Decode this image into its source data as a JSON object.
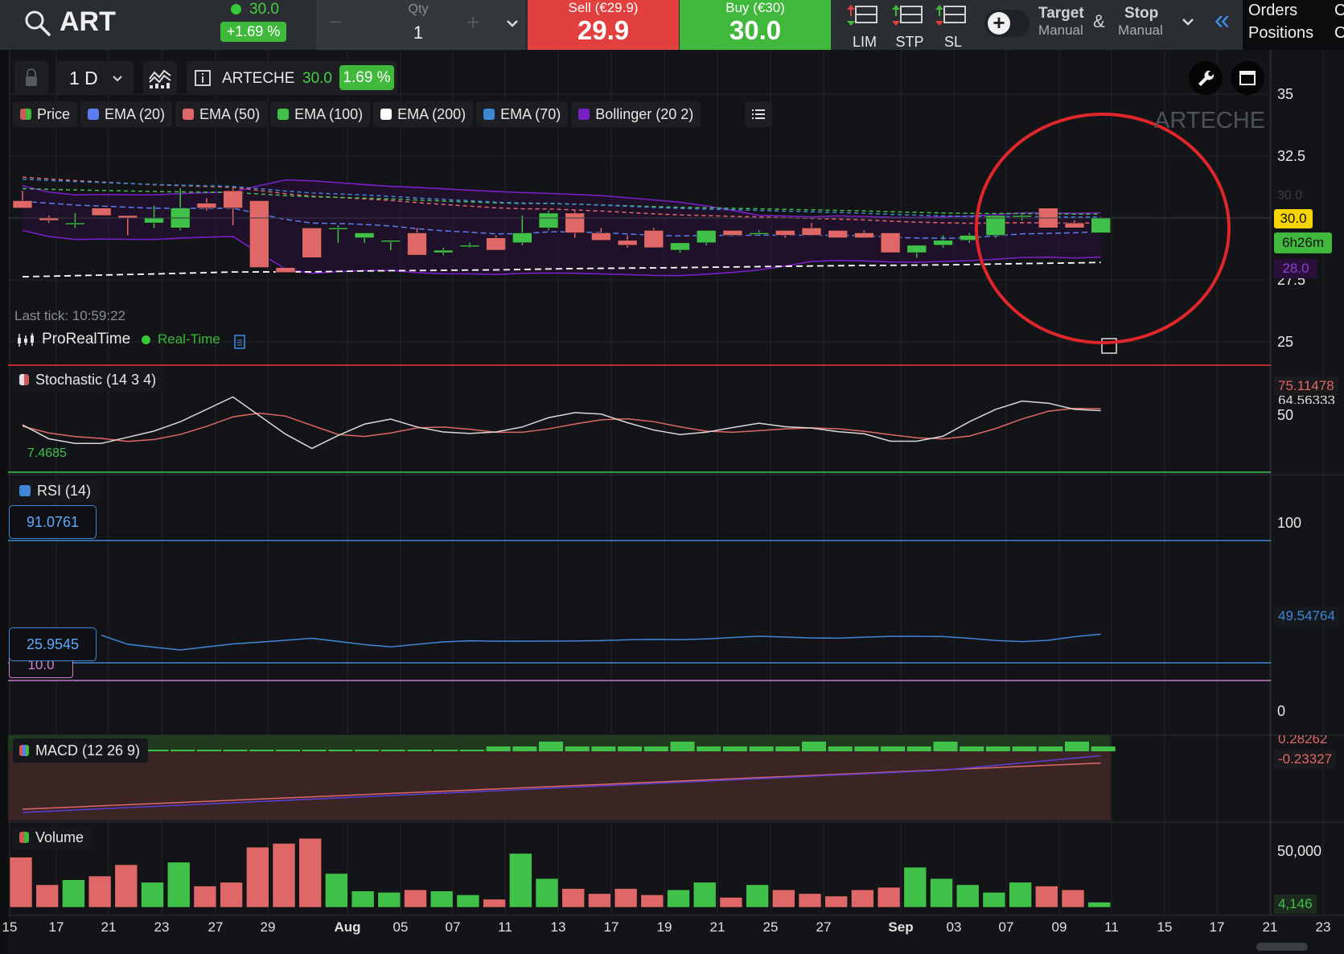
{
  "topbar": {
    "symbol": "ART",
    "last_price": "30.0",
    "change_pct": "+1.69 %",
    "qty_label": "Qty",
    "qty_value": "1",
    "qty_minus": "−",
    "qty_plus": "+",
    "sell_label": "Sell (€29.9)",
    "sell_price": "29.9",
    "buy_label": "Buy (€30)",
    "buy_price": "30.0",
    "order_types": [
      "LIM",
      "STP",
      "SL"
    ],
    "target_label": "Target",
    "target_sub": "Manual",
    "amp": "&",
    "stop_label": "Stop",
    "stop_sub": "Manual",
    "collapse_glyph": "«",
    "orders_label": "Orders",
    "positions_label": "Positions",
    "orders_extra": "C",
    "positions_extra": "C",
    "colors": {
      "sell": "#e2403f",
      "buy": "#3fb83c",
      "dot_green": "#37c837"
    }
  },
  "chart_toolbar": {
    "timeframe": "1 D",
    "instrument": "ARTECHE",
    "instrument_price": "30.0",
    "instrument_change": "1.69 %"
  },
  "legend": [
    {
      "label": "Price",
      "color": "#d05a5a",
      "color2": "#3fb83c"
    },
    {
      "label": "EMA (20)",
      "color": "#5b7cf0"
    },
    {
      "label": "EMA (50)",
      "color": "#e06767"
    },
    {
      "label": "EMA (100)",
      "color": "#3fc14a"
    },
    {
      "label": "EMA (200)",
      "color": "#ffffff"
    },
    {
      "label": "EMA (70)",
      "color": "#3f86d6"
    },
    {
      "label": "Bollinger (20 2)",
      "color": "#7a1fc7"
    }
  ],
  "watermark": "ARTECHE",
  "last_tick": "Last tick: 10:59:22",
  "provider": "ProRealTime",
  "realtime": "Real-Time",
  "price_axis": {
    "ticks": [
      "35",
      "32.5",
      "27.5",
      "25"
    ],
    "hidden_tick": "30.0",
    "last_price_tag": "30.0",
    "countdown_tag": "6h26m",
    "bollinger_tag": "28.0"
  },
  "stochastic": {
    "label": "Stochastic (14 3 4)",
    "value_a": "75.11478",
    "value_b": "64.56333",
    "tick_50": "50",
    "low_label": "7.4685"
  },
  "rsi": {
    "label": "RSI (14)",
    "upper_box": "91.0761",
    "lower_box": "25.9545",
    "hidden_box": "10.0",
    "value": "49.54764",
    "tick_100": "100",
    "tick_0": "0"
  },
  "macd": {
    "label": "MACD (12 26 9)",
    "value_a": "0.28262",
    "value_b": "-0.23327"
  },
  "volume": {
    "label": "Volume",
    "tick_top": "50,000",
    "last_value": "4,146"
  },
  "x_axis": {
    "labels": [
      "15",
      "17",
      "21",
      "23",
      "27",
      "29",
      "Aug",
      "05",
      "07",
      "11",
      "13",
      "17",
      "19",
      "21",
      "25",
      "27",
      "Sep",
      "03",
      "07",
      "09",
      "11",
      "15",
      "17",
      "21",
      "23"
    ],
    "bold": [
      "Aug",
      "Sep"
    ]
  },
  "annotation": {
    "color": "#e1262b"
  },
  "chart_data": {
    "type": "candlestick",
    "candles": [
      {
        "o": 30.7,
        "h": 31.1,
        "l": 30.4,
        "c": 30.4
      },
      {
        "o": 30.0,
        "h": 30.1,
        "l": 29.8,
        "c": 29.9
      },
      {
        "o": 29.8,
        "h": 30.2,
        "l": 29.6,
        "c": 29.8
      },
      {
        "o": 30.4,
        "h": 30.4,
        "l": 30.1,
        "c": 30.1
      },
      {
        "o": 30.1,
        "h": 30.1,
        "l": 29.3,
        "c": 30.0
      },
      {
        "o": 29.8,
        "h": 30.5,
        "l": 29.6,
        "c": 30.0
      },
      {
        "o": 29.6,
        "h": 31.2,
        "l": 29.5,
        "c": 30.4
      },
      {
        "o": 30.6,
        "h": 30.8,
        "l": 30.3,
        "c": 30.4
      },
      {
        "o": 31.1,
        "h": 31.2,
        "l": 29.7,
        "c": 30.4
      },
      {
        "o": 30.7,
        "h": 30.7,
        "l": 28.0,
        "c": 28.0
      },
      {
        "o": 28.0,
        "h": 28.0,
        "l": 27.8,
        "c": 27.8
      },
      {
        "o": 29.6,
        "h": 29.6,
        "l": 28.4,
        "c": 28.4
      },
      {
        "o": 29.6,
        "h": 29.7,
        "l": 29.0,
        "c": 29.6
      },
      {
        "o": 29.2,
        "h": 29.4,
        "l": 29.0,
        "c": 29.4
      },
      {
        "o": 29.1,
        "h": 29.1,
        "l": 28.7,
        "c": 29.1
      },
      {
        "o": 29.4,
        "h": 29.6,
        "l": 28.6,
        "c": 28.5
      },
      {
        "o": 28.6,
        "h": 28.8,
        "l": 28.5,
        "c": 28.7
      },
      {
        "o": 28.9,
        "h": 29.0,
        "l": 28.8,
        "c": 28.9
      },
      {
        "o": 29.2,
        "h": 29.3,
        "l": 28.7,
        "c": 28.7
      },
      {
        "o": 29.0,
        "h": 30.1,
        "l": 28.9,
        "c": 29.4
      },
      {
        "o": 29.6,
        "h": 30.3,
        "l": 29.5,
        "c": 30.2
      },
      {
        "o": 30.2,
        "h": 30.3,
        "l": 29.2,
        "c": 29.4
      },
      {
        "o": 29.4,
        "h": 29.6,
        "l": 29.1,
        "c": 29.1
      },
      {
        "o": 29.1,
        "h": 29.3,
        "l": 28.8,
        "c": 28.9
      },
      {
        "o": 29.5,
        "h": 29.6,
        "l": 28.8,
        "c": 28.8
      },
      {
        "o": 28.7,
        "h": 29.0,
        "l": 28.6,
        "c": 29.0
      },
      {
        "o": 29.0,
        "h": 29.5,
        "l": 28.9,
        "c": 29.5
      },
      {
        "o": 29.5,
        "h": 29.5,
        "l": 29.3,
        "c": 29.3
      },
      {
        "o": 29.4,
        "h": 29.5,
        "l": 29.3,
        "c": 29.4
      },
      {
        "o": 29.5,
        "h": 29.5,
        "l": 29.2,
        "c": 29.3
      },
      {
        "o": 29.6,
        "h": 29.8,
        "l": 29.3,
        "c": 29.3
      },
      {
        "o": 29.5,
        "h": 29.5,
        "l": 29.2,
        "c": 29.2
      },
      {
        "o": 29.4,
        "h": 29.5,
        "l": 29.2,
        "c": 29.2
      },
      {
        "o": 29.4,
        "h": 29.4,
        "l": 28.6,
        "c": 28.6
      },
      {
        "o": 28.6,
        "h": 28.9,
        "l": 28.4,
        "c": 28.9
      },
      {
        "o": 28.9,
        "h": 29.3,
        "l": 28.8,
        "c": 29.1
      },
      {
        "o": 29.1,
        "h": 29.4,
        "l": 29.0,
        "c": 29.3
      },
      {
        "o": 29.3,
        "h": 30.1,
        "l": 29.2,
        "c": 30.1
      },
      {
        "o": 30.1,
        "h": 30.2,
        "l": 29.9,
        "c": 30.1
      },
      {
        "o": 30.4,
        "h": 30.4,
        "l": 29.6,
        "c": 29.6
      },
      {
        "o": 29.8,
        "h": 29.9,
        "l": 29.6,
        "c": 29.6
      },
      {
        "o": 29.4,
        "h": 30.0,
        "l": 29.4,
        "c": 30.0
      }
    ],
    "volume_max_tick": 50000,
    "volume_last": 4146,
    "y_ticks": [
      35,
      32.5,
      27.5,
      25
    ]
  }
}
